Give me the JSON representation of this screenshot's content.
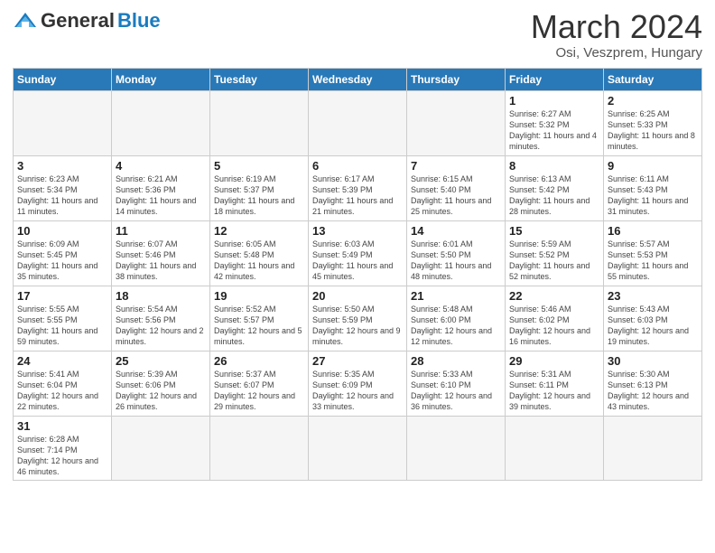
{
  "header": {
    "logo_general": "General",
    "logo_blue": "Blue",
    "month_title": "March 2024",
    "location": "Osi, Veszprem, Hungary"
  },
  "weekdays": [
    "Sunday",
    "Monday",
    "Tuesday",
    "Wednesday",
    "Thursday",
    "Friday",
    "Saturday"
  ],
  "weeks": [
    [
      {
        "day": "",
        "info": ""
      },
      {
        "day": "",
        "info": ""
      },
      {
        "day": "",
        "info": ""
      },
      {
        "day": "",
        "info": ""
      },
      {
        "day": "",
        "info": ""
      },
      {
        "day": "1",
        "info": "Sunrise: 6:27 AM\nSunset: 5:32 PM\nDaylight: 11 hours\nand 4 minutes."
      },
      {
        "day": "2",
        "info": "Sunrise: 6:25 AM\nSunset: 5:33 PM\nDaylight: 11 hours\nand 8 minutes."
      }
    ],
    [
      {
        "day": "3",
        "info": "Sunrise: 6:23 AM\nSunset: 5:34 PM\nDaylight: 11 hours\nand 11 minutes."
      },
      {
        "day": "4",
        "info": "Sunrise: 6:21 AM\nSunset: 5:36 PM\nDaylight: 11 hours\nand 14 minutes."
      },
      {
        "day": "5",
        "info": "Sunrise: 6:19 AM\nSunset: 5:37 PM\nDaylight: 11 hours\nand 18 minutes."
      },
      {
        "day": "6",
        "info": "Sunrise: 6:17 AM\nSunset: 5:39 PM\nDaylight: 11 hours\nand 21 minutes."
      },
      {
        "day": "7",
        "info": "Sunrise: 6:15 AM\nSunset: 5:40 PM\nDaylight: 11 hours\nand 25 minutes."
      },
      {
        "day": "8",
        "info": "Sunrise: 6:13 AM\nSunset: 5:42 PM\nDaylight: 11 hours\nand 28 minutes."
      },
      {
        "day": "9",
        "info": "Sunrise: 6:11 AM\nSunset: 5:43 PM\nDaylight: 11 hours\nand 31 minutes."
      }
    ],
    [
      {
        "day": "10",
        "info": "Sunrise: 6:09 AM\nSunset: 5:45 PM\nDaylight: 11 hours\nand 35 minutes."
      },
      {
        "day": "11",
        "info": "Sunrise: 6:07 AM\nSunset: 5:46 PM\nDaylight: 11 hours\nand 38 minutes."
      },
      {
        "day": "12",
        "info": "Sunrise: 6:05 AM\nSunset: 5:48 PM\nDaylight: 11 hours\nand 42 minutes."
      },
      {
        "day": "13",
        "info": "Sunrise: 6:03 AM\nSunset: 5:49 PM\nDaylight: 11 hours\nand 45 minutes."
      },
      {
        "day": "14",
        "info": "Sunrise: 6:01 AM\nSunset: 5:50 PM\nDaylight: 11 hours\nand 48 minutes."
      },
      {
        "day": "15",
        "info": "Sunrise: 5:59 AM\nSunset: 5:52 PM\nDaylight: 11 hours\nand 52 minutes."
      },
      {
        "day": "16",
        "info": "Sunrise: 5:57 AM\nSunset: 5:53 PM\nDaylight: 11 hours\nand 55 minutes."
      }
    ],
    [
      {
        "day": "17",
        "info": "Sunrise: 5:55 AM\nSunset: 5:55 PM\nDaylight: 11 hours\nand 59 minutes."
      },
      {
        "day": "18",
        "info": "Sunrise: 5:54 AM\nSunset: 5:56 PM\nDaylight: 12 hours\nand 2 minutes."
      },
      {
        "day": "19",
        "info": "Sunrise: 5:52 AM\nSunset: 5:57 PM\nDaylight: 12 hours\nand 5 minutes."
      },
      {
        "day": "20",
        "info": "Sunrise: 5:50 AM\nSunset: 5:59 PM\nDaylight: 12 hours\nand 9 minutes."
      },
      {
        "day": "21",
        "info": "Sunrise: 5:48 AM\nSunset: 6:00 PM\nDaylight: 12 hours\nand 12 minutes."
      },
      {
        "day": "22",
        "info": "Sunrise: 5:46 AM\nSunset: 6:02 PM\nDaylight: 12 hours\nand 16 minutes."
      },
      {
        "day": "23",
        "info": "Sunrise: 5:43 AM\nSunset: 6:03 PM\nDaylight: 12 hours\nand 19 minutes."
      }
    ],
    [
      {
        "day": "24",
        "info": "Sunrise: 5:41 AM\nSunset: 6:04 PM\nDaylight: 12 hours\nand 22 minutes."
      },
      {
        "day": "25",
        "info": "Sunrise: 5:39 AM\nSunset: 6:06 PM\nDaylight: 12 hours\nand 26 minutes."
      },
      {
        "day": "26",
        "info": "Sunrise: 5:37 AM\nSunset: 6:07 PM\nDaylight: 12 hours\nand 29 minutes."
      },
      {
        "day": "27",
        "info": "Sunrise: 5:35 AM\nSunset: 6:09 PM\nDaylight: 12 hours\nand 33 minutes."
      },
      {
        "day": "28",
        "info": "Sunrise: 5:33 AM\nSunset: 6:10 PM\nDaylight: 12 hours\nand 36 minutes."
      },
      {
        "day": "29",
        "info": "Sunrise: 5:31 AM\nSunset: 6:11 PM\nDaylight: 12 hours\nand 39 minutes."
      },
      {
        "day": "30",
        "info": "Sunrise: 5:30 AM\nSunset: 6:13 PM\nDaylight: 12 hours\nand 43 minutes."
      }
    ],
    [
      {
        "day": "31",
        "info": "Sunrise: 6:28 AM\nSunset: 7:14 PM\nDaylight: 12 hours\nand 46 minutes."
      },
      {
        "day": "",
        "info": ""
      },
      {
        "day": "",
        "info": ""
      },
      {
        "day": "",
        "info": ""
      },
      {
        "day": "",
        "info": ""
      },
      {
        "day": "",
        "info": ""
      },
      {
        "day": "",
        "info": ""
      }
    ]
  ]
}
